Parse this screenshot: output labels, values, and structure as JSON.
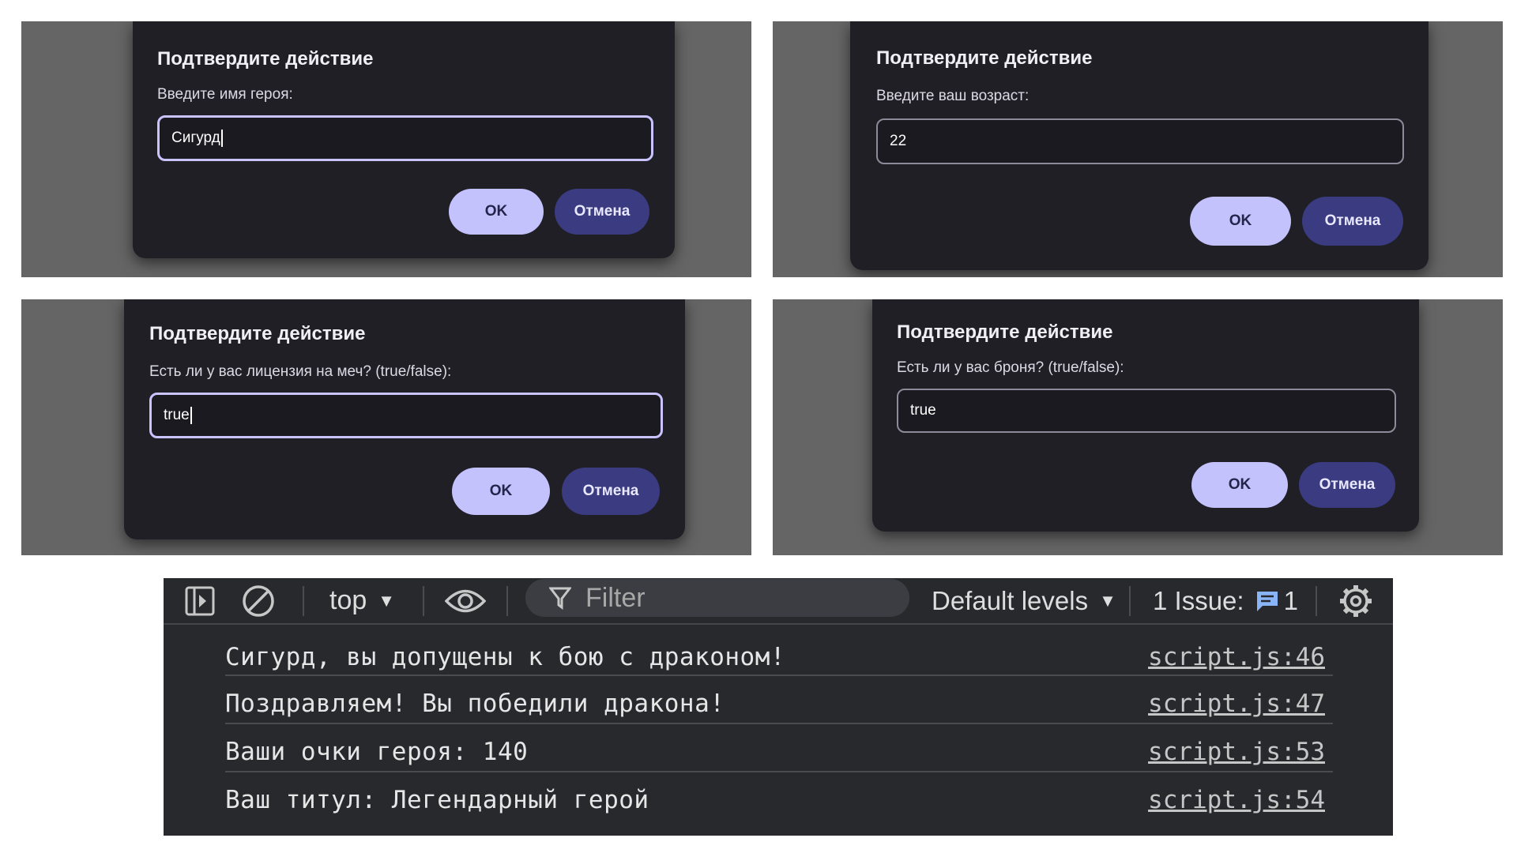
{
  "dialogs": [
    {
      "title": "Подтвердите действие",
      "prompt": "Введите имя героя:",
      "input_value": "Сигурд",
      "focused": true,
      "ok_label": "OK",
      "cancel_label": "Отмена"
    },
    {
      "title": "Подтвердите действие",
      "prompt": "Введите ваш возраст:",
      "input_value": "22",
      "focused": false,
      "ok_label": "OK",
      "cancel_label": "Отмена"
    },
    {
      "title": "Подтвердите действие",
      "prompt": "Есть ли у вас лицензия на меч? (true/false):",
      "input_value": "true",
      "focused": true,
      "ok_label": "OK",
      "cancel_label": "Отмена"
    },
    {
      "title": "Подтвердите действие",
      "prompt": "Есть ли у вас броня? (true/false):",
      "input_value": "true",
      "focused": false,
      "ok_label": "OK",
      "cancel_label": "Отмена"
    }
  ],
  "console": {
    "toolbar": {
      "sidebar_icon": "sidebar-toggle-icon",
      "clear_icon": "clear-console-icon",
      "context": "top",
      "eye_icon": "live-expression-icon",
      "filter_placeholder": "Filter",
      "levels": "Default levels",
      "issues_label": "1 Issue:",
      "issues_count": "1",
      "settings_icon": "gear-icon"
    },
    "logs": [
      {
        "message": "Сигурд, вы допущены к бою с драконом!",
        "source": "script.js:46"
      },
      {
        "message": "Поздравляем! Вы победили дракона!",
        "source": "script.js:47"
      },
      {
        "message": "Ваши очки героя: 140",
        "source": "script.js:53"
      },
      {
        "message": "Ваш титул: Легендарный герой",
        "source": "script.js:54"
      }
    ]
  },
  "colors": {
    "dialog_bg": "#201f26",
    "ok_button": "#c4c2fd",
    "cancel_button": "#3a3b80",
    "focus_ring": "#c9c3ff",
    "console_bg": "#28292c"
  }
}
